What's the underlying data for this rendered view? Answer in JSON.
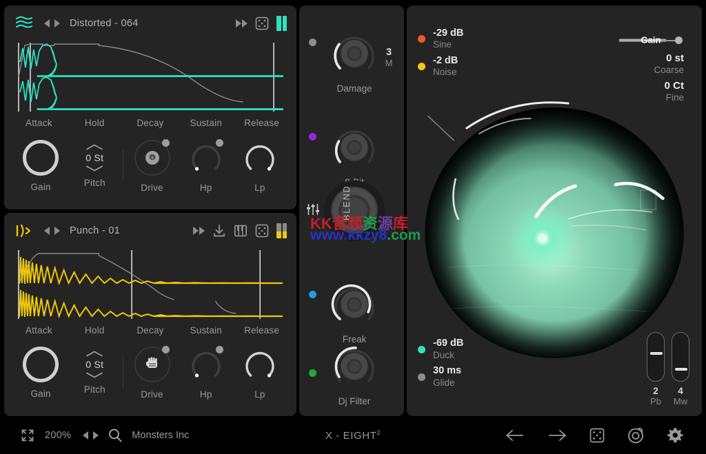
{
  "layers": [
    {
      "icon": "waveform-lines-icon",
      "accent": "#2ee0c0",
      "preset": "Distorted - 064",
      "icons": [
        "fast-forward-icon",
        "dice-icon",
        "meter-icon"
      ],
      "env_labels": [
        "Attack",
        "Hold",
        "Decay",
        "Sustain",
        "Release"
      ],
      "knobs": [
        {
          "label": "Gain",
          "type": "ring"
        },
        {
          "label": "Pitch",
          "type": "stepper",
          "value": "0 St"
        },
        {
          "label": "Drive",
          "type": "drive",
          "glyph": "8ball"
        },
        {
          "label": "Hp",
          "type": "arc",
          "pct": 0
        },
        {
          "label": "Lp",
          "type": "arc",
          "pct": 100
        }
      ]
    },
    {
      "icon": "wave-bracket-icon",
      "accent": "#f0c808",
      "preset": "Punch - 01",
      "icons": [
        "fast-forward-icon",
        "download-icon",
        "keyboard-icon",
        "dice-icon",
        "meter-icon"
      ],
      "env_labels": [
        "Attack",
        "Hold",
        "Decay",
        "Sustain",
        "Release"
      ],
      "knobs": [
        {
          "label": "Gain",
          "type": "ring"
        },
        {
          "label": "Pitch",
          "type": "stepper",
          "value": "0 St"
        },
        {
          "label": "Drive",
          "type": "drive",
          "glyph": "fist"
        },
        {
          "label": "Hp",
          "type": "arc",
          "pct": 0
        },
        {
          "label": "Lp",
          "type": "arc",
          "pct": 100
        }
      ]
    }
  ],
  "fx": {
    "knobs": [
      {
        "label": "Damage",
        "dot_color": "#8d8d8d",
        "value": "3",
        "unit": "M"
      },
      {
        "label": "8-Bit",
        "dot_color": "#9d1fe8"
      },
      {
        "label": "Blend",
        "dot_color": ""
      },
      {
        "label": "Freak",
        "dot_color": "#1f9ce8"
      },
      {
        "label": "Dj Filter",
        "dot_color": "#1faa3c"
      }
    ],
    "blend_label": "BLEND"
  },
  "right": {
    "readouts_top": [
      {
        "value": "-29 dB",
        "label": "Sine",
        "color": "#f05a28"
      },
      {
        "value": "-2 dB",
        "label": "Noise",
        "color": "#f5c518"
      }
    ],
    "readouts_bottom": [
      {
        "value": "-69 dB",
        "label": "Duck",
        "color": "#2ee0c0"
      },
      {
        "value": "30 ms",
        "label": "Glide",
        "color": "#8d8d8d"
      }
    ],
    "gain_slider_label": "Gain",
    "tuning": [
      {
        "value": "0 st",
        "label": "Coarse"
      },
      {
        "value": "0 Ct",
        "label": "Fine"
      }
    ],
    "vsliders": [
      {
        "value": "2",
        "label": "Pb",
        "pos": 40
      },
      {
        "value": "4",
        "label": "Mw",
        "pos": 73
      }
    ]
  },
  "bottom": {
    "zoom": "200%",
    "browse": "Monsters Inc",
    "title": "X - EIGHT",
    "title_sup": "2",
    "icons": [
      "resize-icon",
      "prev-icon",
      "next-icon",
      "search-icon",
      "arrow-left-icon",
      "arrow-right-icon",
      "dice-icon",
      "target-icon",
      "gear-icon"
    ]
  },
  "watermark": {
    "line1": "KK音频资源库",
    "line2": "www.kkzy8.com"
  }
}
